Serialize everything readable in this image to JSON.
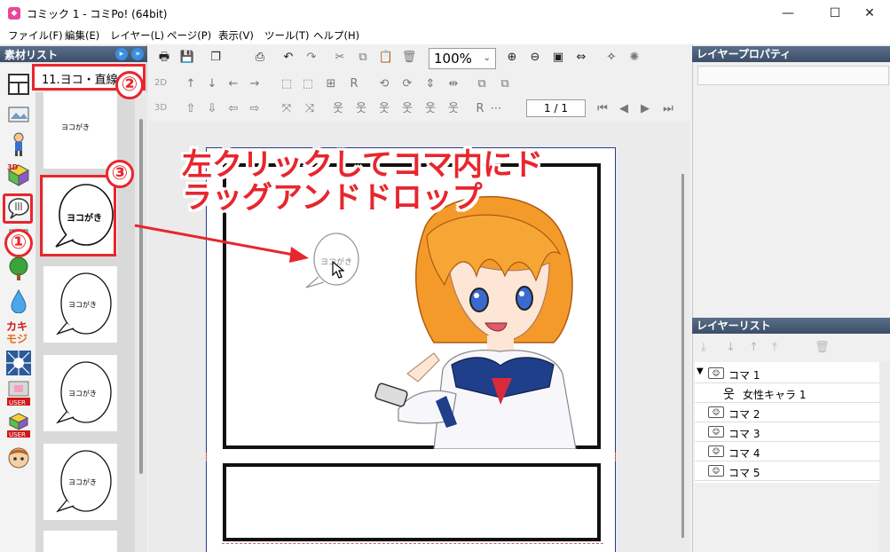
{
  "window": {
    "title": "コミック 1 - コミPo! (64bit)",
    "app_icon": "comipo-app-icon",
    "controls": [
      "minimize",
      "maximize",
      "close"
    ]
  },
  "menu": [
    "ファイル(F)",
    "編集(E)",
    "レイヤー(L)",
    "ページ(P)",
    "表示(V)",
    "ツール(T)",
    "ヘルプ(H)"
  ],
  "material_list": {
    "title": "素材リスト",
    "category": "11.ヨコ・直線",
    "thumbnail_label": "ヨコがき",
    "sidebar_icons": [
      "frame-layout-icon",
      "background-icon",
      "character-icon",
      "3d-object-icon",
      "speech-balloon-icon",
      "text-icon",
      "tree-icon",
      "drop-effect-icon",
      "onomatopoeia-icon",
      "burst-effect-icon",
      "user-material-icon",
      "user-3d-icon",
      "face-icon"
    ]
  },
  "toolbar": {
    "zoom": "100%",
    "page_indicator": "1 / 1",
    "row_labels": [
      "2D",
      "3D"
    ]
  },
  "properties_panel": {
    "title": "レイヤープロパティ"
  },
  "layer_list": {
    "title": "レイヤーリスト",
    "items": [
      {
        "label": "コマ 1",
        "expanded": true,
        "indent": 0
      },
      {
        "label": "女性キャラ 1",
        "indent": 1
      },
      {
        "label": "コマ 2",
        "indent": 0
      },
      {
        "label": "コマ 3",
        "indent": 0
      },
      {
        "label": "コマ 4",
        "indent": 0
      },
      {
        "label": "コマ 5",
        "indent": 0
      }
    ]
  },
  "annotations": {
    "step1": "①",
    "step2": "②",
    "step3": "③",
    "instruction": "左クリックしてコマ内にドラッグアンドドロップ",
    "dragged_balloon_text": "ヨコがき",
    "color": "#e8262d"
  }
}
